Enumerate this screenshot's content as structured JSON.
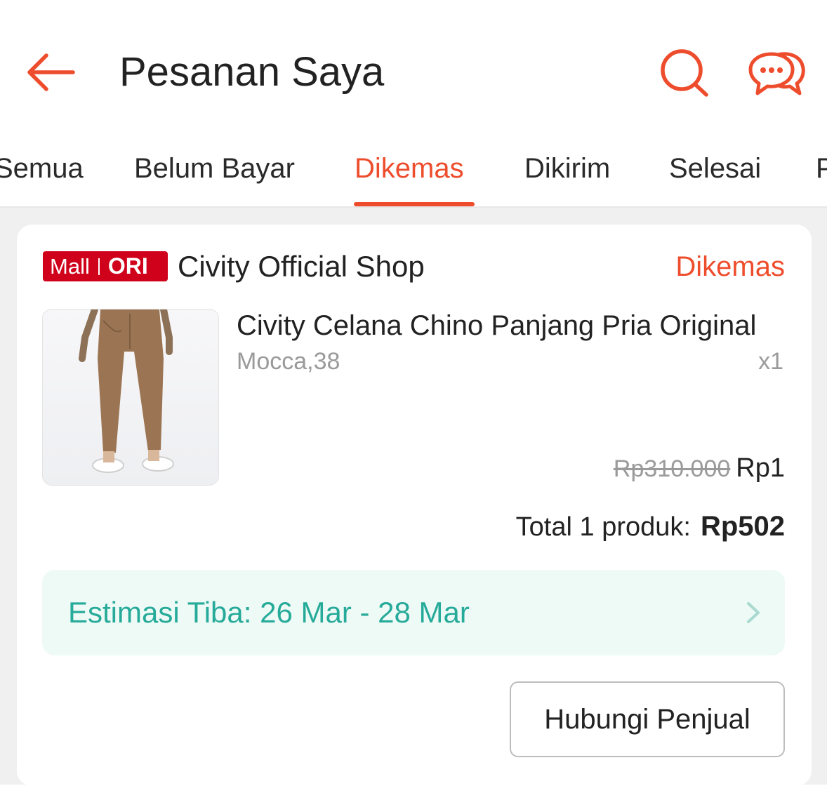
{
  "colors": {
    "accent": "#ee4d2d",
    "mall_badge": "#d0011b",
    "eta_text": "#26aa99",
    "eta_bg": "#eefaf6"
  },
  "header": {
    "title": "Pesanan Saya",
    "icons": [
      "back-arrow-icon",
      "search-icon",
      "chat-icon"
    ]
  },
  "tabs": [
    {
      "label": "Semua",
      "active": false
    },
    {
      "label": "Belum Bayar",
      "active": false
    },
    {
      "label": "Dikemas",
      "active": true
    },
    {
      "label": "Dikirim",
      "active": false
    },
    {
      "label": "Selesai",
      "active": false
    },
    {
      "label": "P",
      "active": false
    }
  ],
  "order": {
    "badge": {
      "mall": "Mall",
      "ori": "ORI"
    },
    "shop_name": "Civity Official Shop",
    "status": "Dikemas",
    "product": {
      "name": "Civity Celana Chino Panjang Pria Original",
      "variant": "Mocca,38",
      "quantity": "x1",
      "price_original": "Rp310.000",
      "price_current": "Rp1"
    },
    "total_label": "Total 1 produk:",
    "total_value": "Rp502",
    "eta": "Estimasi Tiba: 26 Mar - 28 Mar",
    "contact_button": "Hubungi Penjual"
  }
}
